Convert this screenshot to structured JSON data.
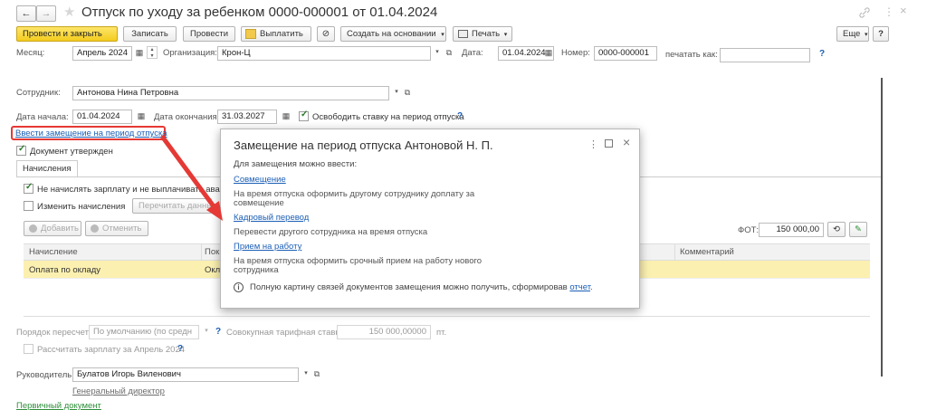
{
  "window": {
    "title": "Отпуск по уходу за ребенком 0000-000001 от 01.04.2024",
    "nav_back": "←",
    "nav_forward": "→",
    "star": "★",
    "link_icon": "link-icon",
    "more_icon": "⋮",
    "close_icon": "×"
  },
  "toolbar": {
    "post_close": "Провести и закрыть",
    "save": "Записать",
    "post": "Провести",
    "pay": "Выплатить",
    "create_based": "Создать на основании",
    "print": "Печать",
    "more": "Еще",
    "help": "?"
  },
  "form": {
    "month_label": "Месяц:",
    "month_value": "Апрель 2024",
    "org_label": "Организация:",
    "org_value": "Крон-Ц",
    "date_label": "Дата:",
    "date_value": "01.04.2024",
    "number_label": "Номер:",
    "number_value": "0000-000001",
    "print_as_label": "печатать как:",
    "print_as_value": "",
    "employee_label": "Сотрудник:",
    "employee_value": "Антонова Нина Петровна",
    "start_label": "Дата начала:",
    "start_value": "01.04.2024",
    "end_label": "Дата окончания:",
    "end_value": "31.03.2027",
    "free_rate_label": "Освободить ставку на период отпуска",
    "substitute_link": "Ввести замещение на период отпуска",
    "approved_label": "Документ утвержден",
    "tab_accruals": "Начисления",
    "no_salary_label": "Не начислять зарплату и не выплачивать аванс во",
    "change_accruals_label": "Изменить начисления",
    "recalc_data_btn": "Перечитать данные",
    "add_btn": "Добавить",
    "cancel_btn": "Отменить",
    "fot_label": "ФОТ:",
    "fot_value": "150 000,00",
    "col_accrual": "Начисление",
    "col_indicators": "Показ",
    "col_comment": "Комментарий",
    "row_accrual": "Оплата по окладу",
    "row_indicator": "Окла",
    "recalc_order_label": "Порядок пересчета:",
    "recalc_order_value": "По умолчанию (по средн",
    "total_rate_label": "Совокупная тарифная ставка:",
    "total_rate_value": "150 000,00000",
    "currency": "пт.",
    "calc_salary_label": "Рассчитать зарплату за Апрель 2024",
    "manager_label": "Руководитель:",
    "manager_value": "Булатов Игорь Виленович",
    "manager_position": "Генеральный директор",
    "primary_doc": "Первичный документ"
  },
  "dialog": {
    "title": "Замещение на период отпуска Антоновой Н. П.",
    "intro": "Для замещения можно ввести:",
    "option1_link": "Совмещение",
    "option1_desc_line1": "На время отпуска оформить другому сотруднику доплату за",
    "option1_desc_line2": "совмещение",
    "option2_link": "Кадровый перевод",
    "option2_desc": "Перевести другого сотрудника на время отпуска",
    "option3_link": "Прием на работу",
    "option3_desc_line1": "На время отпуска оформить срочный прием на работу нового",
    "option3_desc_line2": "сотрудника",
    "info_text": "Полную картину связей документов замещения можно получить, сформировав",
    "info_link": "отчет",
    "info_dot": "."
  },
  "colors": {
    "accent_yellow": "#f4cc1f",
    "highlight_row": "#fbf0b0",
    "annotation_red": "#e53935",
    "link_blue": "#1b5fb6"
  }
}
